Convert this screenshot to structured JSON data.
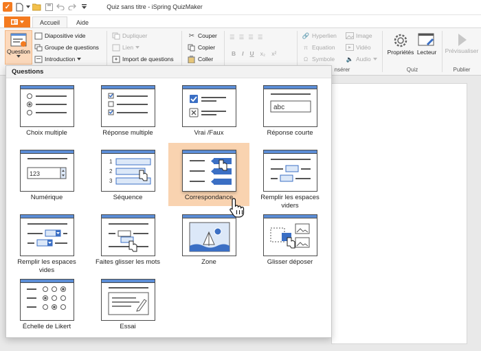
{
  "window": {
    "title": "Quiz sans titre - iSpring QuizMaker"
  },
  "tabs": {
    "file_icon": "ribbon-menu-icon",
    "items": [
      "Accueil",
      "Aide"
    ]
  },
  "ribbon": {
    "question_button": "Question",
    "slides": {
      "diapositive": "Diapositive vide",
      "groupe": "Groupe de questions",
      "introduction": "Introduction"
    },
    "duplicate": {
      "dupliquer": "Dupliquer",
      "lien": "Lien",
      "import": "Import de questions"
    },
    "clipboard": {
      "couper": "Couper",
      "copier": "Copier",
      "coller": "Coller"
    },
    "insert": {
      "hyperlien": "Hyperlien",
      "equation": "Equation",
      "symbole": "Symbole",
      "image": "Image",
      "video": "Vidéo",
      "audio": "Audio",
      "label": "nsérer"
    },
    "quiz": {
      "proprietes": "Propriétés",
      "lecteur": "Lecteur",
      "label": "Quiz"
    },
    "publish": {
      "previsualiser": "Prévisualiser",
      "label": "Publier"
    }
  },
  "panel": {
    "title": "Questions",
    "items": [
      "Choix multiple",
      "Réponse multiple",
      "Vrai /Faux",
      "Réponse courte",
      "Numérique",
      "Séquence",
      "Correspondance",
      "Remplir les espaces viders",
      "Remplir les espaces vides",
      "Faites glisser les mots",
      "Zone",
      "Glisser déposer",
      "Échelle de Likert",
      "Essai"
    ],
    "numeric_value": "123",
    "short_answer_value": "abc",
    "sequence_numbers": [
      "1",
      "2",
      "3"
    ],
    "highlighted": "Correspondance"
  },
  "colors": {
    "accent": "#f47b20",
    "highlight": "#f9d3b0",
    "thumb_header": "#5b8dd6",
    "thumb_fill": "#dce8f8"
  }
}
